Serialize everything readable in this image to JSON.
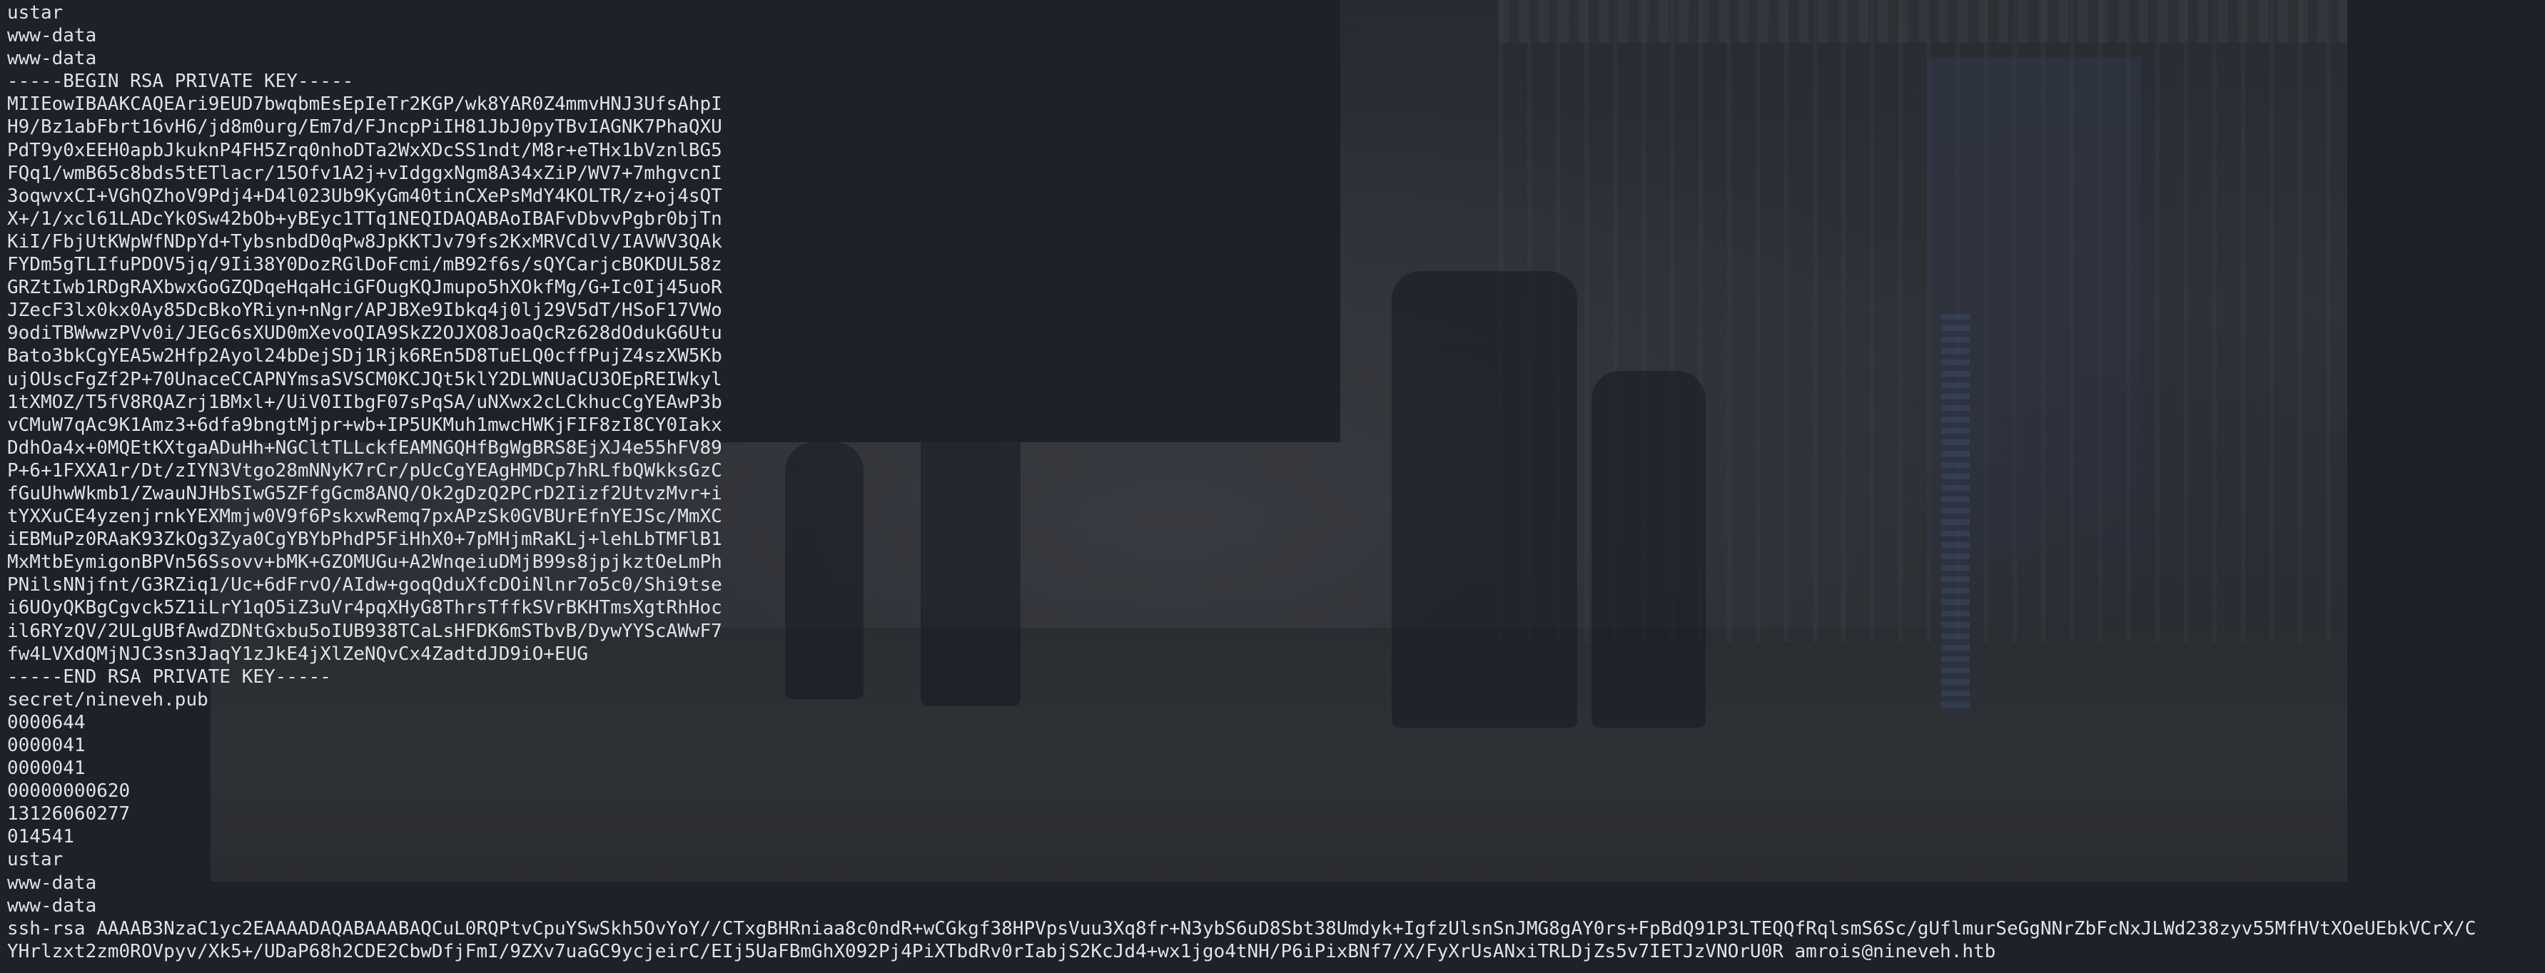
{
  "terminal": {
    "lines": [
      "ustar",
      "www-data",
      "www-data",
      "-----BEGIN RSA PRIVATE KEY-----",
      "MIIEowIBAAKCAQEAri9EUD7bwqbmEsEpIeTr2KGP/wk8YAR0Z4mmvHNJ3UfsAhpI",
      "H9/Bz1abFbrt16vH6/jd8m0urg/Em7d/FJncpPiIH81JbJ0pyTBvIAGNK7PhaQXU",
      "PdT9y0xEEH0apbJkuknP4FH5Zrq0nhoDTa2WxXDcSS1ndt/M8r+eTHx1bVznlBG5",
      "FQq1/wmB65c8bds5tETlacr/15Ofv1A2j+vIdggxNgm8A34xZiP/WV7+7mhgvcnI",
      "3oqwvxCI+VGhQZhoV9Pdj4+D4l023Ub9KyGm40tinCXePsMdY4KOLTR/z+oj4sQT",
      "X+/1/xcl61LADcYk0Sw42bOb+yBEyc1TTq1NEQIDAQABAoIBAFvDbvvPgbr0bjTn",
      "KiI/FbjUtKWpWfNDpYd+TybsnbdD0qPw8JpKKTJv79fs2KxMRVCdlV/IAVWV3QAk",
      "FYDm5gTLIfuPDOV5jq/9Ii38Y0DozRGlDoFcmi/mB92f6s/sQYCarjcBOKDUL58z",
      "GRZtIwb1RDgRAXbwxGoGZQDqeHqaHciGFOugKQJmupo5hXOkfMg/G+Ic0Ij45uoR",
      "JZecF3lx0kx0Ay85DcBkoYRiyn+nNgr/APJBXe9Ibkq4j0lj29V5dT/HSoF17VWo",
      "9odiTBWwwzPVv0i/JEGc6sXUD0mXevoQIA9SkZ2OJXO8JoaQcRz628dOdukG6Utu",
      "Bato3bkCgYEA5w2Hfp2Ayol24bDejSDj1Rjk6REn5D8TuELQ0cffPujZ4szXW5Kb",
      "ujOUscFgZf2P+70UnaceCCAPNYmsaSVSCM0KCJQt5klY2DLWNUaCU3OEpREIWkyl",
      "1tXMOZ/T5fV8RQAZrj1BMxl+/UiV0IIbgF07sPqSA/uNXwx2cLCkhucCgYEAwP3b",
      "vCMuW7qAc9K1Amz3+6dfa9bngtMjpr+wb+IP5UKMuh1mwcHWKjFIF8zI8CY0Iakx",
      "DdhOa4x+0MQEtKXtgaADuHh+NGCltTLLckfEAMNGQHfBgWgBRS8EjXJ4e55hFV89",
      "P+6+1FXXA1r/Dt/zIYN3Vtgo28mNNyK7rCr/pUcCgYEAgHMDCp7hRLfbQWkksGzC",
      "fGuUhwWkmb1/ZwauNJHbSIwG5ZFfgGcm8ANQ/Ok2gDzQ2PCrD2Iizf2UtvzMvr+i",
      "tYXXuCE4yzenjrnkYEXMmjw0V9f6PskxwRemq7pxAPzSk0GVBUrEfnYEJSc/MmXC",
      "iEBMuPz0RAaK93ZkOg3Zya0CgYBYbPhdP5FiHhX0+7pMHjmRaKLj+lehLbTMFlB1",
      "MxMtbEymigonBPVn56Ssovv+bMK+GZOMUGu+A2WnqeiuDMjB99s8jpjkztOeLmPh",
      "PNilsNNjfnt/G3RZiq1/Uc+6dFrvO/AIdw+goqQduXfcDOiNlnr7o5c0/Shi9tse",
      "i6UOyQKBgCgvck5Z1iLrY1qO5iZ3uVr4pqXHyG8ThrsTffkSVrBKHTmsXgtRhHoc",
      "il6RYzQV/2ULgUBfAwdZDNtGxbu5oIUB938TCaLsHFDK6mSTbvB/DywYYScAWwF7",
      "fw4LVXdQMjNJC3sn3JaqY1zJkE4jXlZeNQvCx4ZadtdJD9iO+EUG",
      "-----END RSA PRIVATE KEY-----",
      "secret/nineveh.pub",
      "0000644",
      "0000041",
      "0000041",
      "00000000620",
      "13126060277",
      "014541",
      "ustar",
      "www-data",
      "www-data",
      "ssh-rsa AAAAB3NzaC1yc2EAAAADAQABAAABAQCuL0RQPtvCpuYSwSkh5OvYoY//CTxgBHRniaa8c0ndR+wCGkgf38HPVpsVuu3Xq8fr+N3ybS6uD8Sbt38Umdyk+IgfzUlsnSnJMG8gAY0rs+FpBdQ91P3LTEQQfRqlsmS6Sc/gUflmurSeGgNNrZbFcNxJLWd238zyv55MfHVtXOeUEbkVCrX/C",
      "YHrlzxt2zm0ROVpyv/Xk5+/UDaP68h2CDE2CbwDfjFmI/9ZXv7uaGC9ycjeirC/EIj5UaFBmGhX092Pj4PiXTbdRv0rIabjS2KcJd4+wx1jgo4tNH/P6iPixBNf7/X/FyXrUsANxiTRLDjZs5v7IETJzVNOrU0R amrois@nineveh.htb"
    ]
  }
}
